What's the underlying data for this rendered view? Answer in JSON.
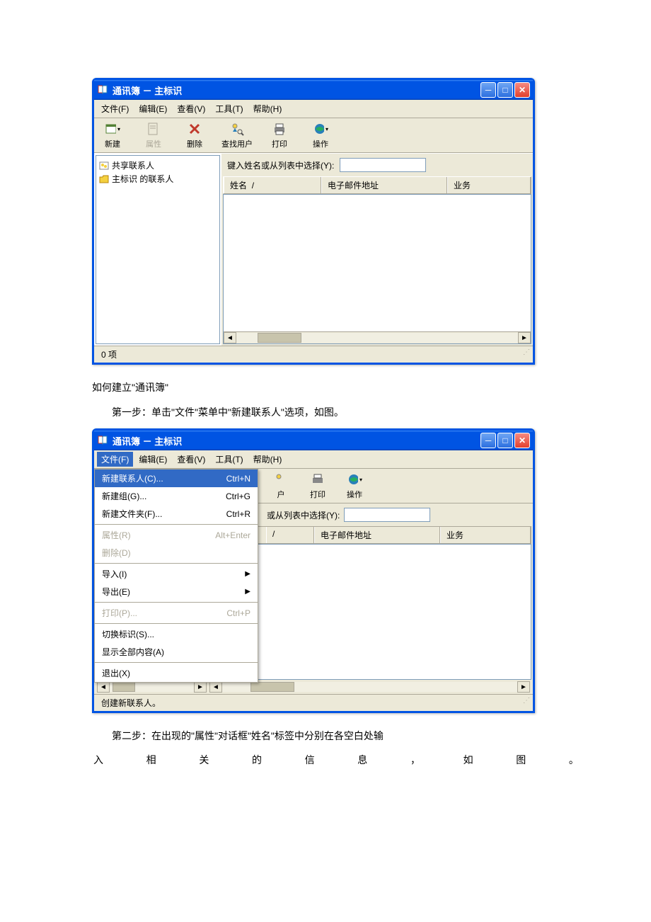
{
  "win1": {
    "title": "通讯簿 － 主标识",
    "menus": {
      "file": "文件(F)",
      "edit": "编辑(E)",
      "view": "查看(V)",
      "tools": "工具(T)",
      "help": "帮助(H)"
    },
    "toolbar": {
      "new": "新建",
      "props": "属性",
      "delete": "删除",
      "find": "查找用户",
      "print": "打印",
      "action": "操作"
    },
    "search_label": "键入姓名或从列表中选择(Y):",
    "cols": {
      "name": "姓名",
      "sort": "/",
      "email": "电子邮件地址",
      "biz": "业务"
    },
    "tree": {
      "shared": "共享联系人",
      "main": "主标识 的联系人"
    },
    "status": "0 项"
  },
  "text": {
    "heading": "如何建立\"通讯簿\"",
    "step1": "第一步：单击\"文件\"菜单中\"新建联系人\"选项，如图。",
    "step2": "第二步：在出现的\"属性\"对话框\"姓名\"标签中分别在各空白处输",
    "step2b": {
      "c1": "入",
      "c2": "相",
      "c3": "关",
      "c4": "的",
      "c5": "信",
      "c6": "息",
      "c7": "，",
      "c8": "如",
      "c9": "图",
      "c10": "。"
    }
  },
  "win2": {
    "title": "通讯簿 － 主标识",
    "menu_items": {
      "new_contact": {
        "label": "新建联系人(C)...",
        "shortcut": "Ctrl+N"
      },
      "new_group": {
        "label": "新建组(G)...",
        "shortcut": "Ctrl+G"
      },
      "new_folder": {
        "label": "新建文件夹(F)...",
        "shortcut": "Ctrl+R"
      },
      "props": {
        "label": "属性(R)",
        "shortcut": "Alt+Enter"
      },
      "delete": {
        "label": "删除(D)"
      },
      "import": {
        "label": "导入(I)"
      },
      "export": {
        "label": "导出(E)"
      },
      "print": {
        "label": "打印(P)...",
        "shortcut": "Ctrl+P"
      },
      "switch": {
        "label": "切换标识(S)..."
      },
      "showall": {
        "label": "显示全部内容(A)"
      },
      "exit": {
        "label": "退出(X)"
      }
    },
    "partial": {
      "find_suffix": "户",
      "print": "打印",
      "action": "操作",
      "search_suffix": "或从列表中选择(Y):",
      "sort": "/",
      "email": "电子邮件地址",
      "biz": "业务"
    },
    "status": "创建新联系人。"
  }
}
